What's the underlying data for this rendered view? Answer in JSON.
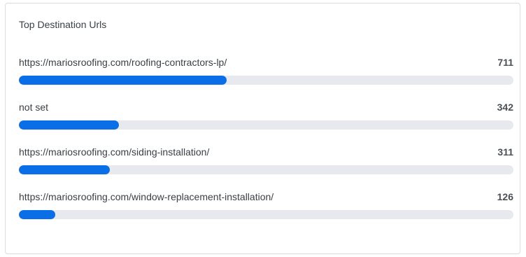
{
  "card": {
    "title": "Top Destination Urls"
  },
  "colors": {
    "bar_fill": "#0a6fe6",
    "bar_track": "#e7e9ee"
  },
  "rows": [
    {
      "label": "https://mariosroofing.com/roofing-contractors-lp/",
      "value": "711",
      "fraction": 0.42
    },
    {
      "label": "not set",
      "value": "342",
      "fraction": 0.2025
    },
    {
      "label": "https://mariosroofing.com/siding-installation/",
      "value": "311",
      "fraction": 0.184
    },
    {
      "label": "https://mariosroofing.com/window-replacement-installation/",
      "value": "126",
      "fraction": 0.074
    }
  ]
}
